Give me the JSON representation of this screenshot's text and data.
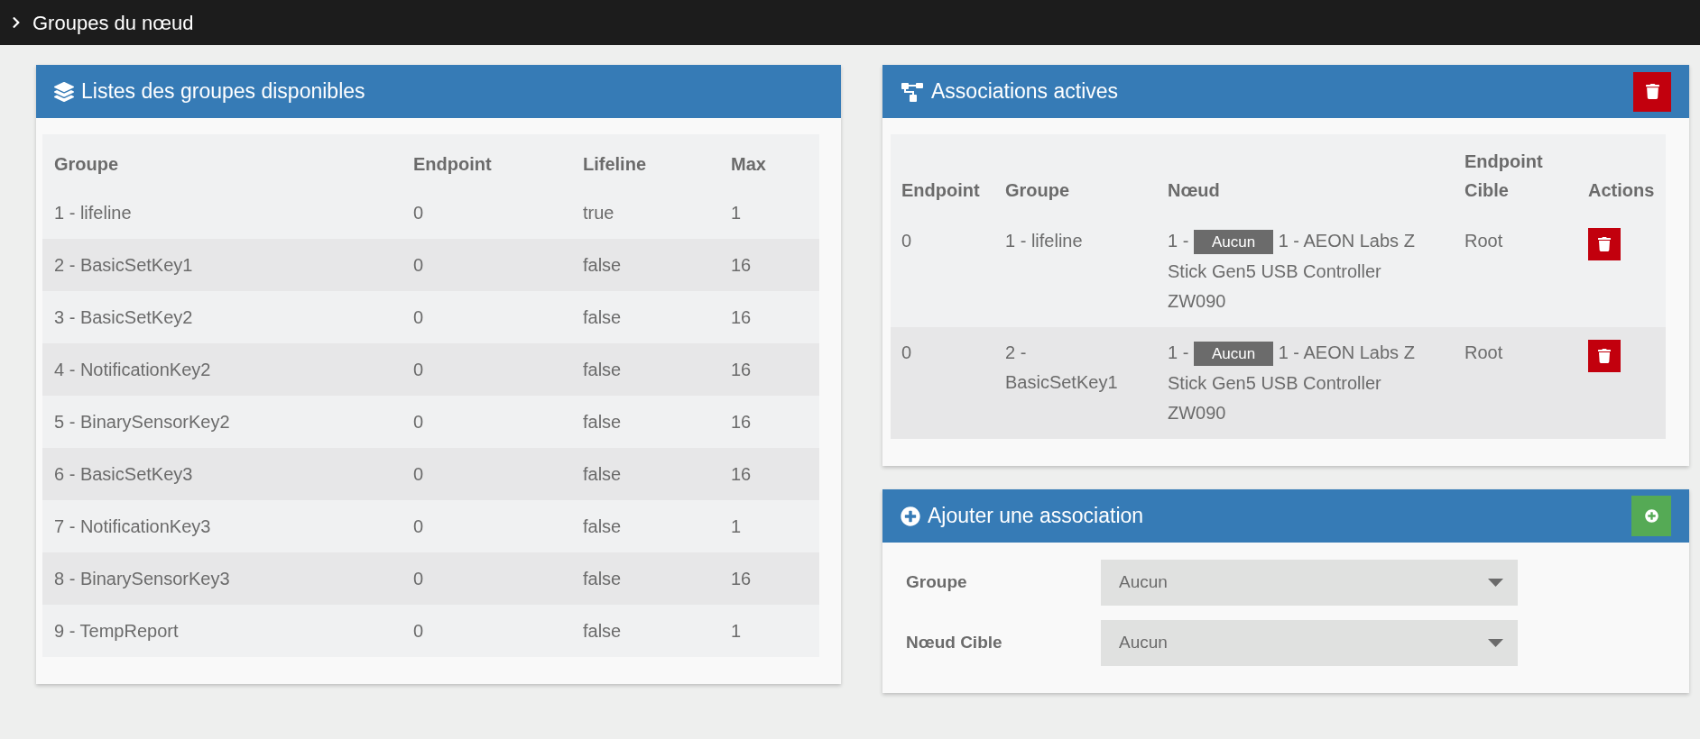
{
  "page_title": "Groupes du nœud",
  "groups_panel": {
    "title": "Listes des groupes disponibles",
    "columns": [
      "Groupe",
      "Endpoint",
      "Lifeline",
      "Max"
    ],
    "rows": [
      {
        "group": "1 - lifeline",
        "endpoint": "0",
        "lifeline": "true",
        "max": "1"
      },
      {
        "group": "2 - BasicSetKey1",
        "endpoint": "0",
        "lifeline": "false",
        "max": "16"
      },
      {
        "group": "3 - BasicSetKey2",
        "endpoint": "0",
        "lifeline": "false",
        "max": "16"
      },
      {
        "group": "4 - NotificationKey2",
        "endpoint": "0",
        "lifeline": "false",
        "max": "16"
      },
      {
        "group": "5 - BinarySensorKey2",
        "endpoint": "0",
        "lifeline": "false",
        "max": "16"
      },
      {
        "group": "6 - BasicSetKey3",
        "endpoint": "0",
        "lifeline": "false",
        "max": "16"
      },
      {
        "group": "7 - NotificationKey3",
        "endpoint": "0",
        "lifeline": "false",
        "max": "1"
      },
      {
        "group": "8 - BinarySensorKey3",
        "endpoint": "0",
        "lifeline": "false",
        "max": "16"
      },
      {
        "group": "9 - TempReport",
        "endpoint": "0",
        "lifeline": "false",
        "max": "1"
      }
    ]
  },
  "associations_panel": {
    "title": "Associations actives",
    "columns": [
      "Endpoint",
      "Groupe",
      "Nœud",
      "Endpoint Cible",
      "Actions"
    ],
    "rows": [
      {
        "endpoint": "0",
        "group": "1 - lifeline",
        "node_prefix": "1 -",
        "node_badge": "Aucun",
        "node_name": "1 - AEON Labs Z Stick Gen5 USB Controller ZW090",
        "target_endpoint": "Root"
      },
      {
        "endpoint": "0",
        "group": "2 - BasicSetKey1",
        "node_prefix": "1 -",
        "node_badge": "Aucun",
        "node_name": "1 - AEON Labs Z Stick Gen5 USB Controller ZW090",
        "target_endpoint": "Root"
      }
    ]
  },
  "add_panel": {
    "title": "Ajouter une association",
    "fields": [
      {
        "label": "Groupe",
        "value": "Aucun"
      },
      {
        "label": "Nœud Cible",
        "value": "Aucun"
      }
    ]
  }
}
